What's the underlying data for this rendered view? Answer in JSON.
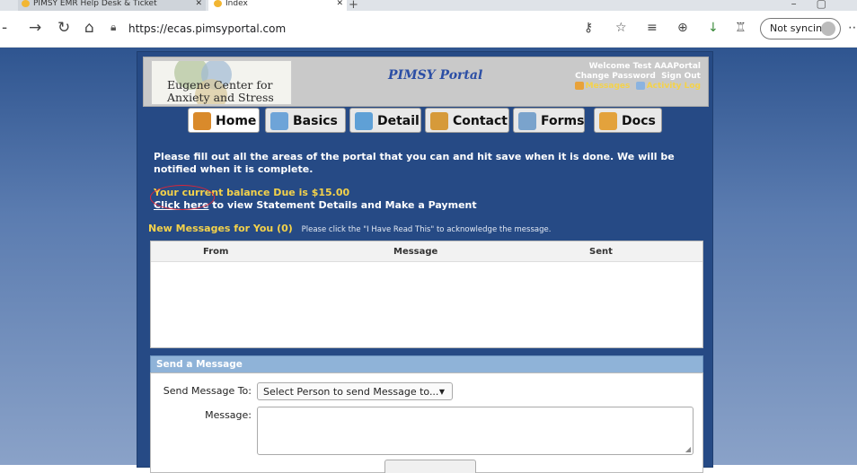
{
  "browser": {
    "tabs": [
      {
        "title": "PIMSY EMR Help Desk & Ticket",
        "close": "✕"
      },
      {
        "title": "Index",
        "close": "✕"
      }
    ],
    "new_tab": "+",
    "url": "https://ecas.pimsyportal.com",
    "sync_label": "Not syncing"
  },
  "portal": {
    "logo_line1": "Eugene Center for",
    "logo_line2": "Anxiety and Stress",
    "title": "PIMSY Portal",
    "welcome": "Welcome Test AAAPortal",
    "change_password": "Change Password",
    "sign_out": "Sign Out",
    "messages_link": "Messages",
    "activity_link": "Activity Log",
    "tabs": [
      {
        "label": "Home",
        "color": "#d98a2b"
      },
      {
        "label": "Basics",
        "color": "#6ea4d8"
      },
      {
        "label": "Detail",
        "color": "#5fa0d6"
      },
      {
        "label": "Contact",
        "color": "#d69a3a"
      },
      {
        "label": "Forms",
        "color": "#7aa3cc"
      },
      {
        "label": "Docs",
        "color": "#e3a23c"
      }
    ],
    "intro": "Please fill out all the areas of the portal that you can and hit save when it is done.  We will be notified when it is complete.",
    "balance": "Your current balance Due is $15.00",
    "click_here": "Click here",
    "pay_text": " to view Statement Details and Make a Payment",
    "new_messages": "New Messages for You (0)",
    "messages_hint": "Please click the \"I Have Read This\" to acknowledge the message.",
    "table_headers": {
      "from": "From",
      "message": "Message",
      "sent": "Sent"
    },
    "send_title": "Send a Message",
    "send_to_label": "Send Message To:",
    "send_to_value": "Select Person to send Message to...",
    "message_label": "Message:"
  }
}
